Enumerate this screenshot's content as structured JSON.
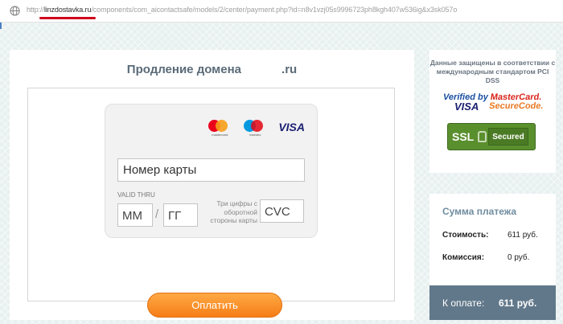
{
  "browser": {
    "url_scheme": "http://",
    "url_host": "linzdostavka.ru",
    "url_path": "/components/com_aicontactsafe/models/2/center/payment.php?id=n8v1vzj05s9996723ph8kgh407w536ig&x3sk057o"
  },
  "payment": {
    "title_prefix": "Продление домена",
    "title_suffix": ".ru",
    "logos": {
      "mastercard_caption": "mastercard",
      "maestro_caption": "maestro",
      "visa": "VISA"
    },
    "card_number_placeholder": "Номер карты",
    "valid_thru_label": "VALID THRU",
    "month_placeholder": "ММ",
    "slash": "/",
    "year_placeholder": "ГГ",
    "cvc_hint": "Три цифры с оборотной стороны карты",
    "cvc_placeholder": "CVC",
    "pay_button": "Оплатить"
  },
  "security": {
    "text": "Данные защищены в соответствии с международным стандартом PCI DSS",
    "verified_by_line1": "Verified by",
    "verified_by_line2": "VISA",
    "mastercard_line1": "MasterCard.",
    "mastercard_line2": "SecureCode.",
    "ssl": "SSL",
    "secured": "Secured"
  },
  "summary": {
    "title": "Сумма платежа",
    "cost_label": "Стоимость:",
    "cost_value": "611 руб.",
    "fee_label": "Комиссия:",
    "fee_value": "0 руб.",
    "total_label": "К оплате:",
    "total_value": "611 руб."
  },
  "colors": {
    "pay_button": "#f57d17",
    "total_bar": "#61788a",
    "title_text": "#5a6b79"
  },
  "icons": [
    "globe-icon",
    "mastercard-icon",
    "maestro-icon",
    "visa-icon",
    "lock-icon"
  ]
}
